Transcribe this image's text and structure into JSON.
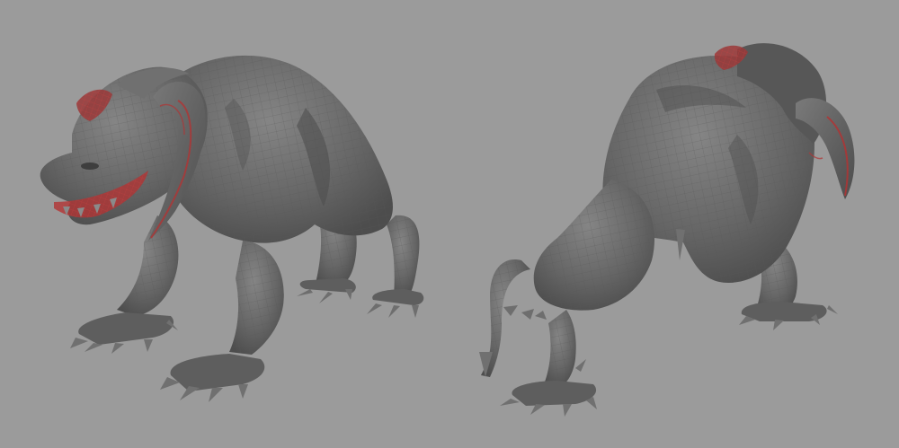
{
  "viewport": {
    "background_color": "#9b9b9b",
    "model_base_color": "#666666",
    "model_shade_color": "#4d4d4d",
    "model_highlight_color": "#858585",
    "wireframe_color": "#575757",
    "horn_mouth_color": "#b03434",
    "claw_color": "#7a7a7a"
  },
  "models": [
    {
      "name": "creature-front-three-quarter-view",
      "view": "front"
    },
    {
      "name": "creature-rear-three-quarter-view",
      "view": "rear"
    }
  ]
}
